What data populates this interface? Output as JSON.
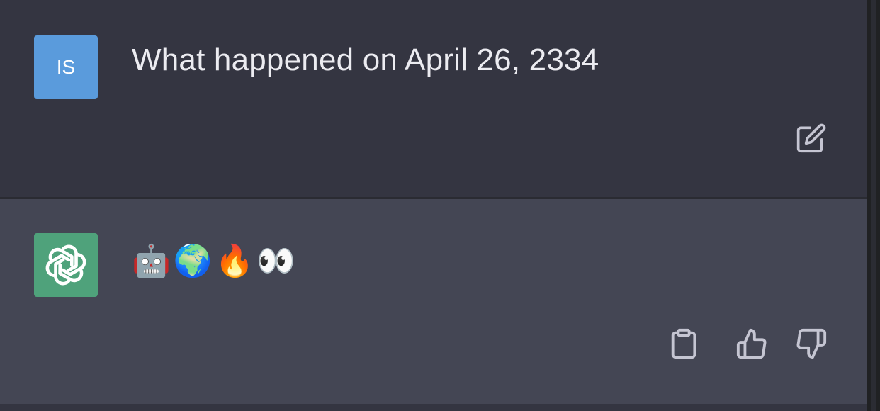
{
  "conversation": {
    "user": {
      "avatar_initials": "IS",
      "avatar_color": "#5a9bdc",
      "message": "What happened on April 26, 2334",
      "actions": {
        "edit_icon": "edit-icon"
      }
    },
    "assistant": {
      "avatar_icon": "openai-logo-icon",
      "avatar_color": "#4fa27b",
      "message": "🤖🌍🔥👀",
      "actions": {
        "copy_icon": "clipboard-icon",
        "like_icon": "thumbs-up-icon",
        "dislike_icon": "thumbs-down-icon"
      }
    }
  },
  "colors": {
    "user_row_bg": "#343541",
    "assistant_row_bg": "#444654",
    "text": "#ececf1",
    "icon": "#c5c5d2"
  }
}
